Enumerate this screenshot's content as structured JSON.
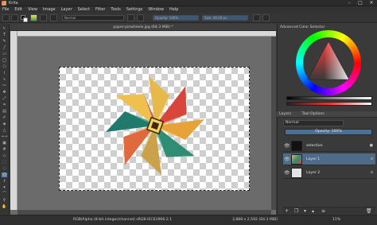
{
  "window": {
    "title": "Krita",
    "minimize": "–",
    "maximize": "□",
    "close": "✕"
  },
  "menu": [
    "File",
    "Edit",
    "View",
    "Image",
    "Layer",
    "Select",
    "Filter",
    "Tools",
    "Settings",
    "Window",
    "Help"
  ],
  "toolbar": {
    "brush_preset_field": "Normal",
    "opacity_label": "Opacity: 100%",
    "size_label": "Size: 40.00 px"
  },
  "document": {
    "tab_title": "paper-pinwheels.jpg (64.3 MiB) *"
  },
  "colors": {
    "accent": "#5a7fa6",
    "selection_row": "#4f6b8a",
    "canvas_bg": "#6b6b6b"
  },
  "right_panel": {
    "color_selector_title": "Advanced Color Selector",
    "tabs": [
      "Layers",
      "Tool Options"
    ],
    "blend_mode": "Normal",
    "opacity": "Opacity: 100%",
    "layers": [
      {
        "name": "selection",
        "selected": false
      },
      {
        "name": "Layer 1",
        "selected": true
      },
      {
        "name": "Layer 2",
        "selected": false
      }
    ]
  },
  "status": {
    "left": "RGB/Alpha (8-bit integer/channel)  sRGB-IEC61966-2.1",
    "center": "3,888 x 2,592 (64.3 MiB)",
    "zoom": "11%"
  }
}
